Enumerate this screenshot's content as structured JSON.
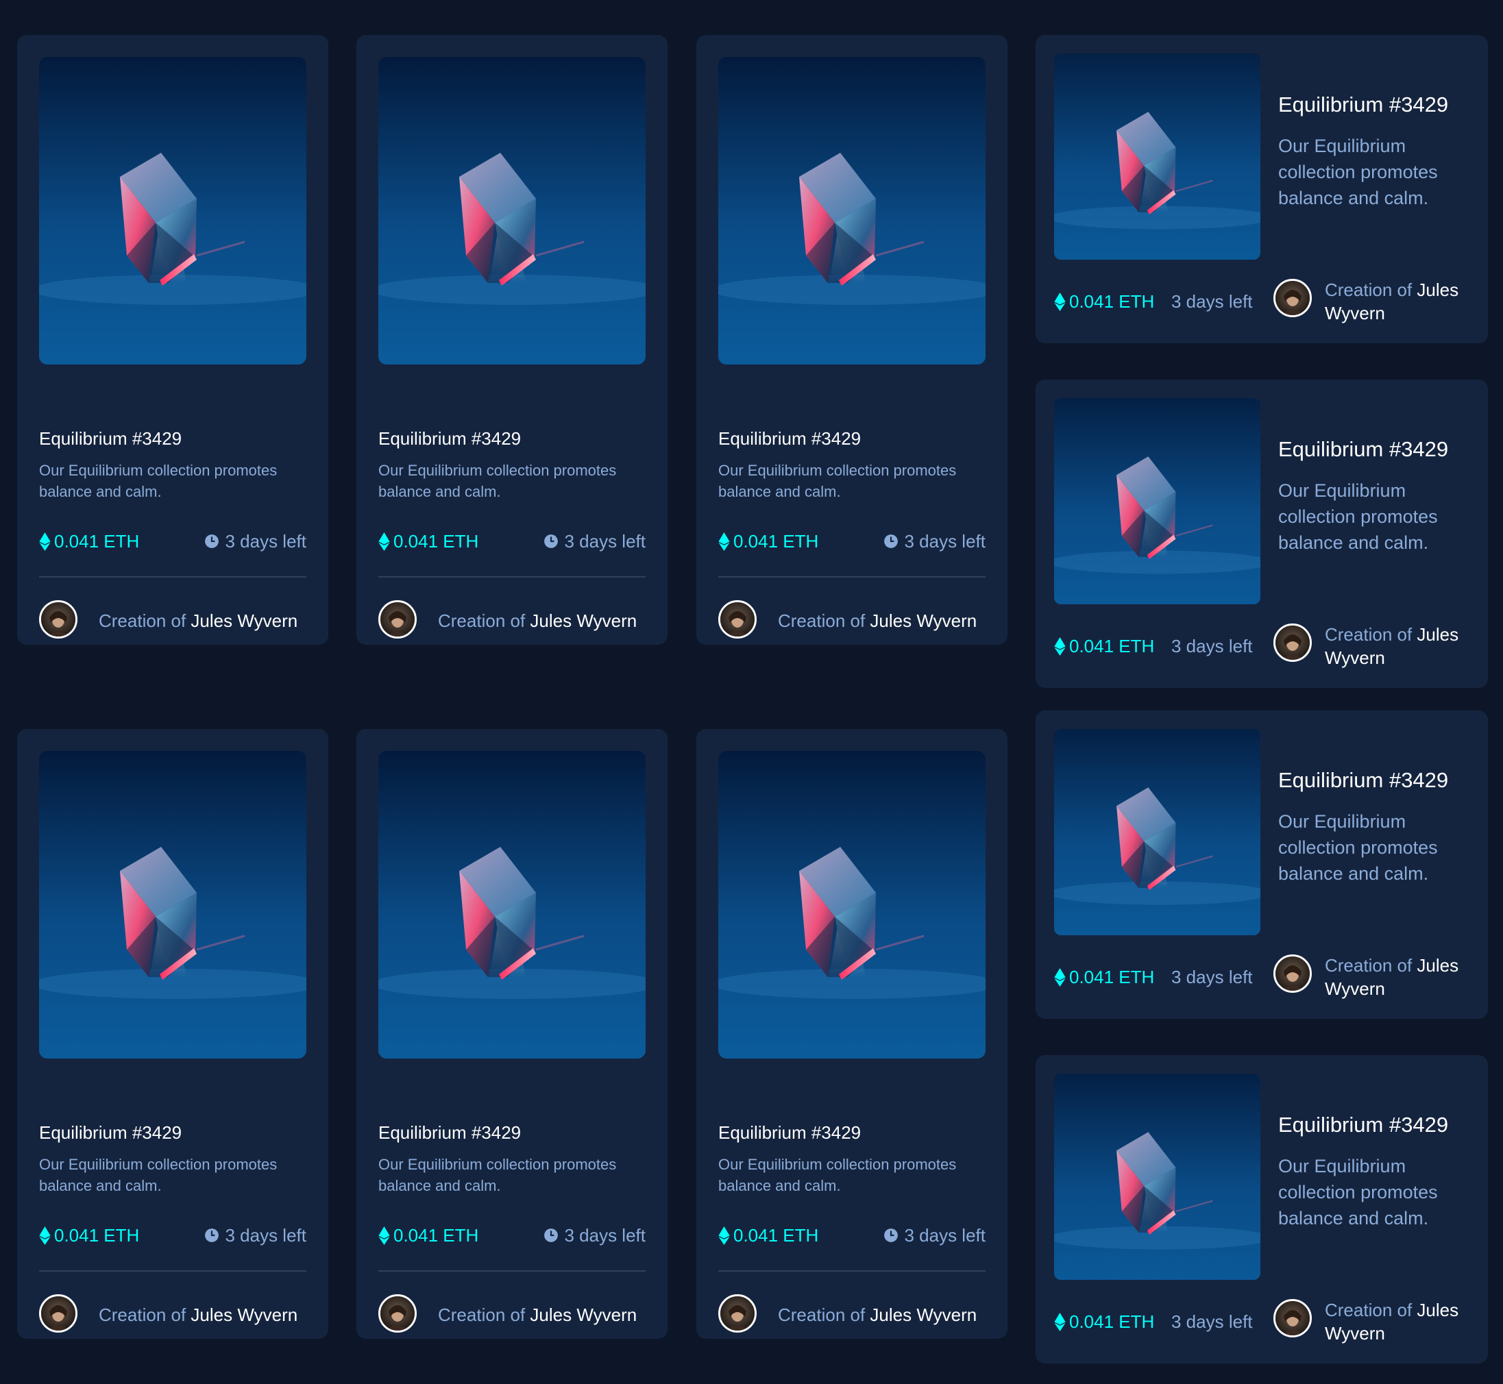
{
  "colors": {
    "page_background": "#0d1628",
    "card_background": "#15243e",
    "accent_cyan": "#00fff8",
    "soft_blue": "#8bacd9",
    "white": "#ffffff",
    "divider": "#2e405a"
  },
  "vertical_cards": [
    {
      "title": "Equilibrium #3429",
      "description": "Our Equilibrium collection promotes balance and calm.",
      "price": "0.041 ETH",
      "time_left": "3 days left",
      "creator_prefix": "Creation of",
      "creator_name": "Jules Wyvern",
      "price_icon": "ethereum-icon",
      "time_icon": "clock-icon"
    },
    {
      "title": "Equilibrium #3429",
      "description": "Our Equilibrium collection promotes balance and calm.",
      "price": "0.041 ETH",
      "time_left": "3 days left",
      "creator_prefix": "Creation of",
      "creator_name": "Jules Wyvern",
      "price_icon": "ethereum-icon",
      "time_icon": "clock-icon"
    },
    {
      "title": "Equilibrium #3429",
      "description": "Our Equilibrium collection promotes balance and calm.",
      "price": "0.041 ETH",
      "time_left": "3 days left",
      "creator_prefix": "Creation of",
      "creator_name": "Jules Wyvern",
      "price_icon": "ethereum-icon",
      "time_icon": "clock-icon"
    },
    {
      "title": "Equilibrium #3429",
      "description": "Our Equilibrium collection promotes balance and calm.",
      "price": "0.041 ETH",
      "time_left": "3 days left",
      "creator_prefix": "Creation of",
      "creator_name": "Jules Wyvern",
      "price_icon": "ethereum-icon",
      "time_icon": "clock-icon"
    },
    {
      "title": "Equilibrium #3429",
      "description": "Our Equilibrium collection promotes balance and calm.",
      "price": "0.041 ETH",
      "time_left": "3 days left",
      "creator_prefix": "Creation of",
      "creator_name": "Jules Wyvern",
      "price_icon": "ethereum-icon",
      "time_icon": "clock-icon"
    },
    {
      "title": "Equilibrium #3429",
      "description": "Our Equilibrium collection promotes balance and calm.",
      "price": "0.041 ETH",
      "time_left": "3 days left",
      "creator_prefix": "Creation of",
      "creator_name": "Jules Wyvern",
      "price_icon": "ethereum-icon",
      "time_icon": "clock-icon"
    }
  ],
  "horizontal_cards": [
    {
      "title": "Equilibrium #3429",
      "description": "Our Equilibrium collection promotes balance and calm.",
      "price": "0.041 ETH",
      "time_left": "3 days left",
      "creator_prefix": "Creation of",
      "creator_name": "Jules Wyvern",
      "price_icon": "ethereum-icon"
    },
    {
      "title": "Equilibrium #3429",
      "description": "Our Equilibrium collection promotes balance and calm.",
      "price": "0.041 ETH",
      "time_left": "3 days left",
      "creator_prefix": "Creation of",
      "creator_name": "Jules Wyvern",
      "price_icon": "ethereum-icon"
    },
    {
      "title": "Equilibrium #3429",
      "description": "Our Equilibrium collection promotes balance and calm.",
      "price": "0.041 ETH",
      "time_left": "3 days left",
      "creator_prefix": "Creation of",
      "creator_name": "Jules Wyvern",
      "price_icon": "ethereum-icon"
    },
    {
      "title": "Equilibrium #3429",
      "description": "Our Equilibrium collection promotes balance and calm.",
      "price": "0.041 ETH",
      "time_left": "3 days left",
      "creator_prefix": "Creation of",
      "creator_name": "Jules Wyvern",
      "price_icon": "ethereum-icon"
    }
  ]
}
